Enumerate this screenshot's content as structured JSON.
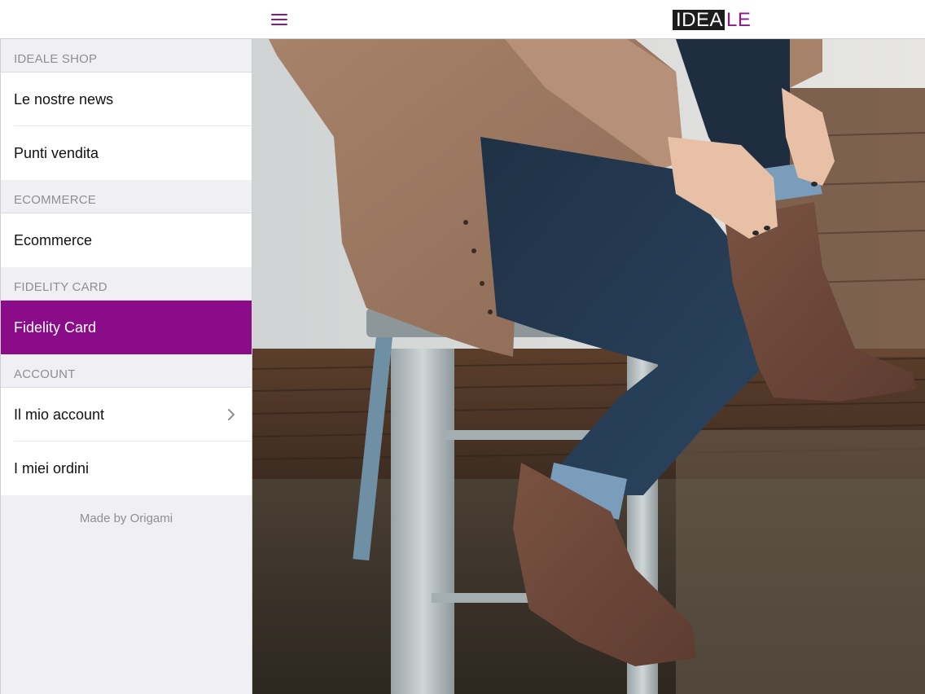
{
  "header": {
    "logo_dark": "IDEA",
    "logo_light": "LE"
  },
  "sidebar": {
    "sections": [
      {
        "title": "IDEALE SHOP",
        "items": [
          "Le nostre news",
          "Punti vendita"
        ]
      },
      {
        "title": "ECOMMERCE",
        "items": [
          "Ecommerce"
        ]
      },
      {
        "title": "FIDELITY CARD",
        "items": [
          "Fidelity Card"
        ]
      },
      {
        "title": "ACCOUNT",
        "items": [
          "Il mio account",
          "I miei ordini"
        ]
      }
    ],
    "footer": "Made by Origami",
    "selected_item": "Fidelity Card"
  },
  "icons": {
    "menu": "hamburger-menu-icon",
    "disclosure": "chevron-right-icon"
  },
  "colors": {
    "accent": "#8b0c88",
    "logo_bg": "#1c1c1c"
  }
}
